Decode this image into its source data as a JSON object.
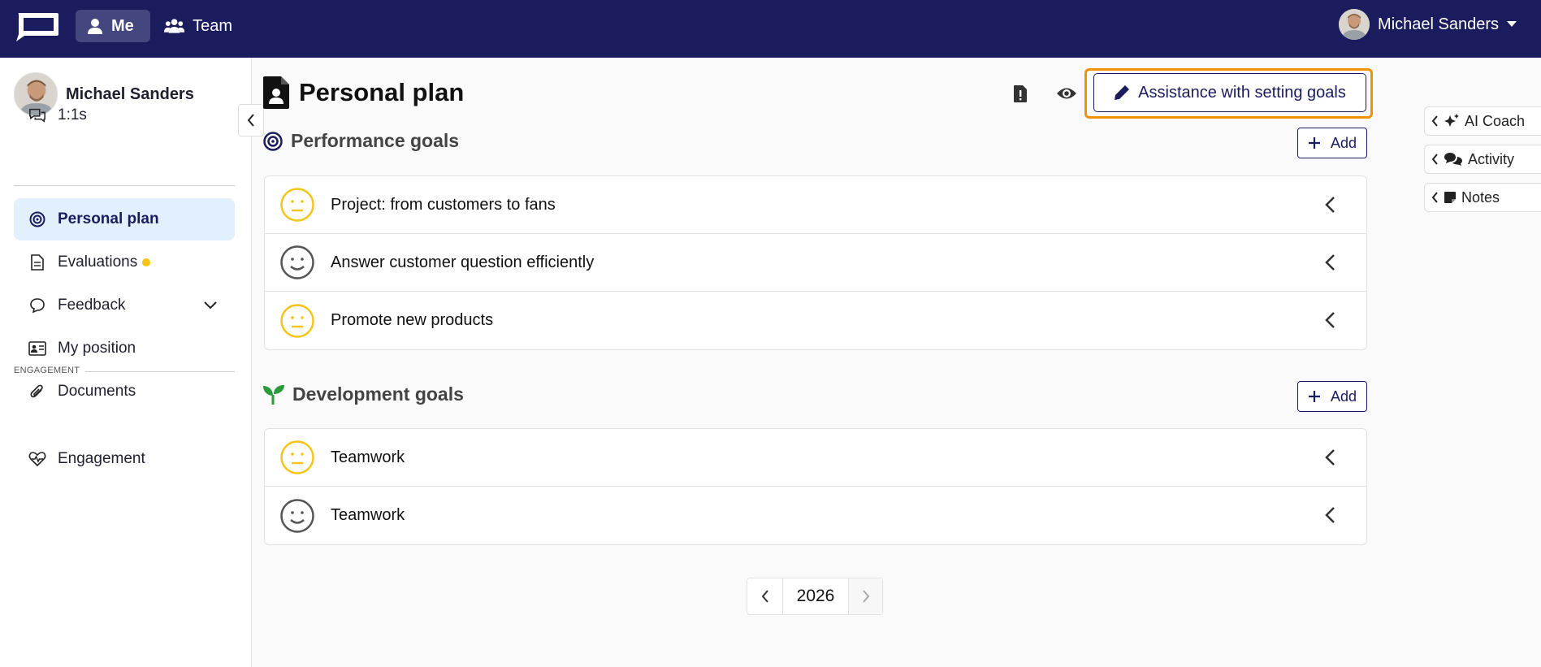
{
  "topbar": {
    "nav": [
      {
        "label": "Me",
        "icon": "user-icon",
        "active": true
      },
      {
        "label": "Team",
        "icon": "users-icon",
        "active": false
      }
    ],
    "user_name": "Michael Sanders"
  },
  "sidebar": {
    "profile_name": "Michael Sanders",
    "items": [
      {
        "label": "1:1s",
        "icon": "chat-bubbles-icon"
      },
      {
        "label": "Personal plan",
        "icon": "target-icon",
        "active": true
      },
      {
        "label": "Evaluations",
        "icon": "document-icon",
        "badge_color": "#f5c518"
      },
      {
        "label": "Feedback",
        "icon": "comment-icon"
      },
      {
        "label": "My position",
        "icon": "id-card-icon"
      },
      {
        "label": "Documents",
        "icon": "paperclip-icon"
      },
      {
        "label": "Engagement",
        "icon": "heartbeat-icon"
      }
    ],
    "section_label": "ENGAGEMENT"
  },
  "main": {
    "title": "Personal plan",
    "assist_button": "Assistance with setting goals",
    "performance": {
      "heading": "Performance goals",
      "add_label": "Add",
      "goals": [
        {
          "title": "Project: from customers to fans",
          "mood": "neutral",
          "color": "#f5c518"
        },
        {
          "title": "Answer customer question efficiently",
          "mood": "smile",
          "color": "#555555"
        },
        {
          "title": "Promote new products",
          "mood": "neutral",
          "color": "#f5c518"
        }
      ]
    },
    "development": {
      "heading": "Development goals",
      "add_label": "Add",
      "goals": [
        {
          "title": "Teamwork",
          "mood": "neutral",
          "color": "#f5c518"
        },
        {
          "title": "Teamwork",
          "mood": "smile",
          "color": "#555555"
        }
      ]
    },
    "year": "2026"
  },
  "right_panel": {
    "tabs": [
      {
        "label": "AI Coach",
        "icon": "sparkles-icon"
      },
      {
        "label": "Activity",
        "icon": "comments-icon"
      },
      {
        "label": "Notes",
        "icon": "sticky-note-icon"
      }
    ]
  },
  "colors": {
    "navy": "#1b1c5e",
    "highlight": "#f39200",
    "active_bg": "#e2effc",
    "yellow": "#f5c518"
  }
}
